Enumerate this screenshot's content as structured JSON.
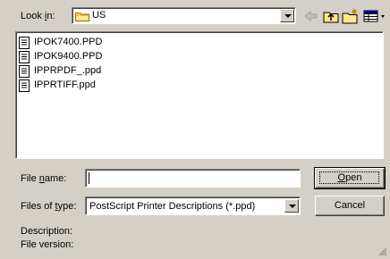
{
  "look_in": {
    "label_pre": "Look ",
    "label_key": "i",
    "label_post": "n:",
    "value": "US",
    "folder_icon": "folder-icon"
  },
  "toolbar": {
    "back_icon": "back-arrow-icon",
    "up_icon": "up-folder-icon",
    "new_folder_icon": "new-folder-icon",
    "view_icon": "view-menu-icon"
  },
  "files": [
    {
      "name": "IPOK7400.PPD"
    },
    {
      "name": "IPOK9400.PPD"
    },
    {
      "name": "IPPRPDF_.ppd"
    },
    {
      "name": "IPPRTIFF.ppd"
    }
  ],
  "file_name": {
    "label_pre": "File ",
    "label_key": "n",
    "label_post": "ame:",
    "value": ""
  },
  "file_type": {
    "label_pre": "Files of ",
    "label_key": "t",
    "label_post": "ype:",
    "value": "PostScript Printer Descriptions (*.ppd)"
  },
  "buttons": {
    "open_key": "O",
    "open_rest": "pen",
    "cancel": "Cancel"
  },
  "info": {
    "description_label": "Description:",
    "version_label": "File version:"
  }
}
